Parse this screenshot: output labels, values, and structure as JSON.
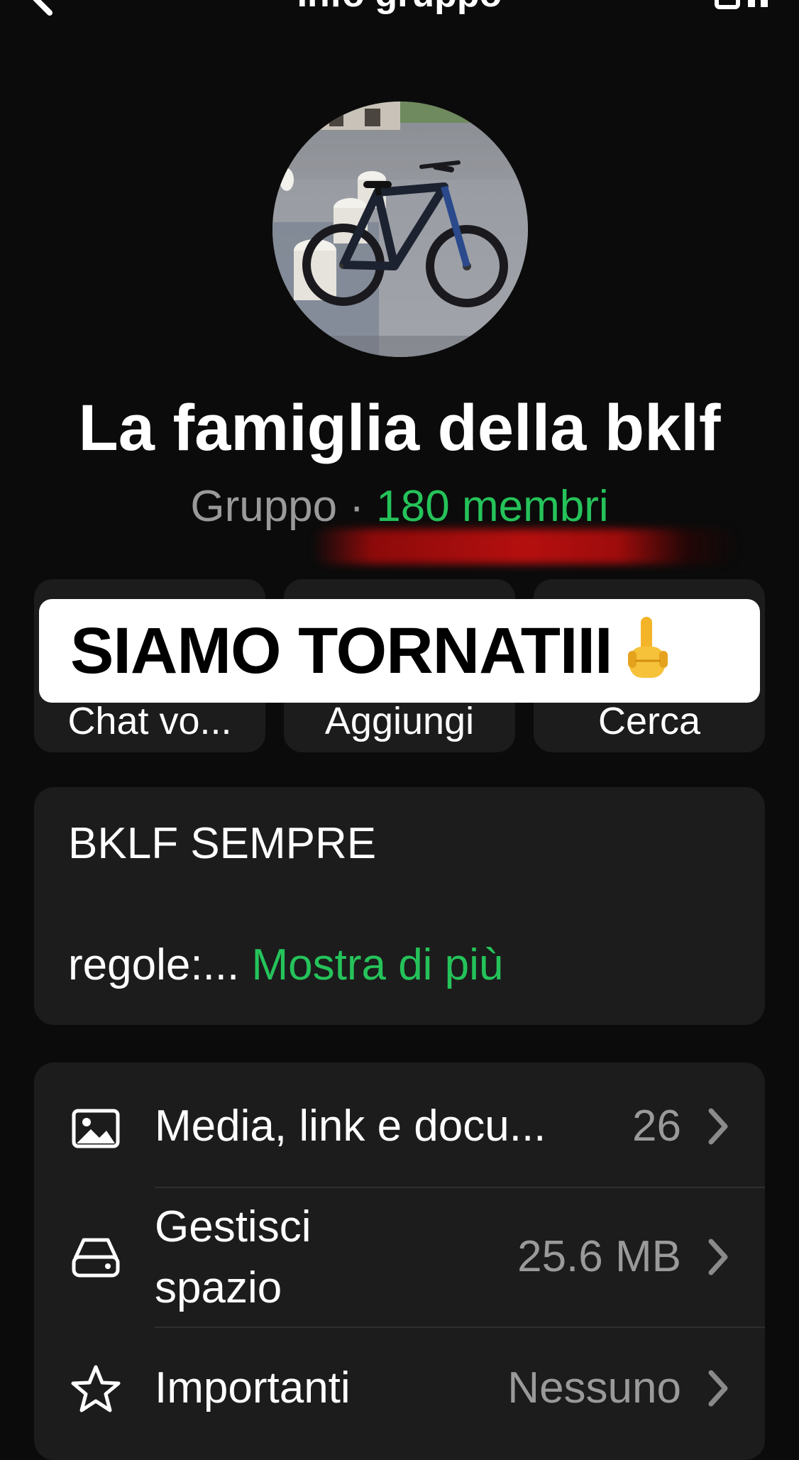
{
  "header": {
    "title": "Info gruppo",
    "back_icon": "chevron-left-icon",
    "action_icon": "qr-code-icon"
  },
  "group": {
    "name": "La famiglia della bklf",
    "type_label": "Gruppo",
    "separator": "·",
    "members": "180 membri"
  },
  "overlay": {
    "banner_text": "SIAMO TORNATIII",
    "emoji": "middle-finger-emoji"
  },
  "actions": [
    {
      "label": "Chat vo...",
      "icon": "phone-icon"
    },
    {
      "label": "Aggiungi",
      "icon": "add-user-icon"
    },
    {
      "label": "Cerca",
      "icon": "search-icon"
    }
  ],
  "description": {
    "title": "BKLF SEMPRE",
    "rules": "regole:...",
    "more": "Mostra di più"
  },
  "list": [
    {
      "label": "Media, link e docu...",
      "value": "26",
      "icon": "image-icon"
    },
    {
      "label_line1": "Gestisci",
      "label_line2": "spazio",
      "value": "25.6 MB",
      "icon": "storage-icon"
    },
    {
      "label": "Importanti",
      "value": "Nessuno",
      "icon": "star-icon"
    }
  ],
  "colors": {
    "background": "#0b0b0b",
    "card": "#1c1c1c",
    "accent": "#25c35a",
    "muted": "#9a9a9a"
  }
}
